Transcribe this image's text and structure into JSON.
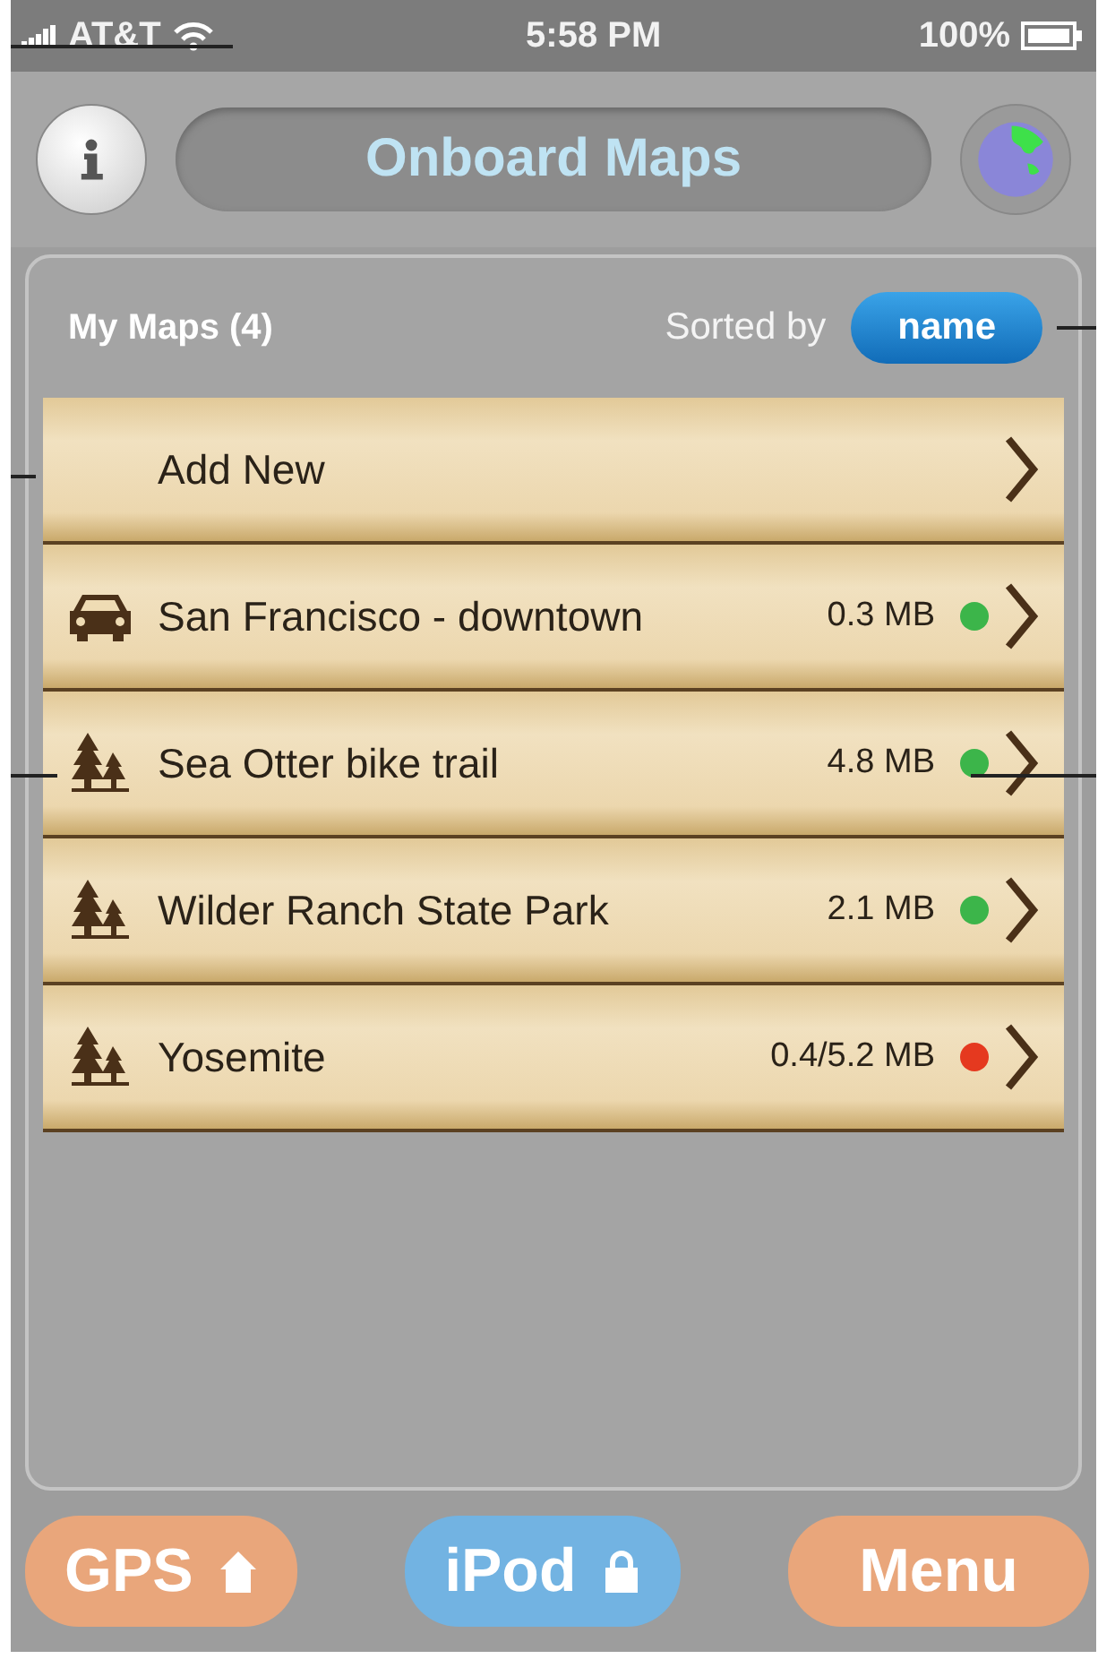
{
  "status_bar": {
    "carrier": "AT&T",
    "time": "5:58 PM",
    "battery": "100%"
  },
  "header": {
    "title": "Onboard Maps"
  },
  "list_header": {
    "title": "My Maps (4)",
    "sort_label": "Sorted by",
    "sort_value": "name"
  },
  "rows": [
    {
      "kind": "add",
      "label": "Add New"
    },
    {
      "kind": "car",
      "label": "San Francisco - downtown",
      "size": "0.3 MB",
      "color": "#3cb54a"
    },
    {
      "kind": "trees",
      "label": "Sea Otter bike trail",
      "size": "4.8 MB",
      "color": "#3cb54a"
    },
    {
      "kind": "trees",
      "label": "Wilder Ranch State Park",
      "size": "2.1 MB",
      "color": "#3cb54a"
    },
    {
      "kind": "trees",
      "label": "Yosemite",
      "size": "0.4/5.2 MB",
      "color": "#e5391f"
    }
  ],
  "toolbar": [
    {
      "kind": "home",
      "label": "GPS"
    },
    {
      "kind": "lock",
      "label": "iPod"
    },
    {
      "kind": "plain",
      "label": "Menu"
    }
  ]
}
